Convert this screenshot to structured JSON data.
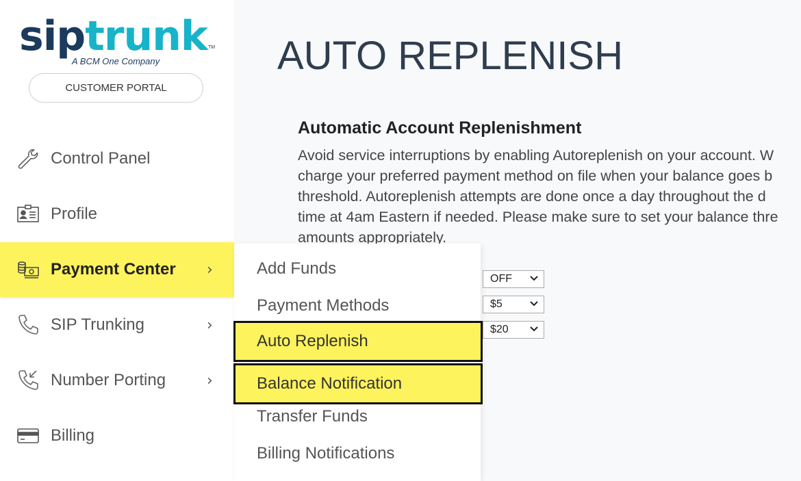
{
  "logo": {
    "sip": "sip",
    "trunk": "trunk",
    "tagline": "A BCM One Company",
    "tm": "TM"
  },
  "sidebar": {
    "portal_button": "CUSTOMER PORTAL",
    "items": [
      {
        "label": "Control Panel",
        "icon": "wrench-icon",
        "has_chevron": false
      },
      {
        "label": "Profile",
        "icon": "id-card-icon",
        "has_chevron": false
      },
      {
        "label": "Payment Center",
        "icon": "cash-stack-icon",
        "has_chevron": true,
        "active": true
      },
      {
        "label": "SIP Trunking",
        "icon": "phone-icon",
        "has_chevron": true
      },
      {
        "label": "Number Porting",
        "icon": "phone-incoming-icon",
        "has_chevron": true
      },
      {
        "label": "Billing",
        "icon": "credit-card-icon",
        "has_chevron": false
      }
    ],
    "chevron": "›"
  },
  "submenu": {
    "items": [
      {
        "label": "Add Funds"
      },
      {
        "label": "Payment Methods"
      },
      {
        "label": "Auto Replenish",
        "highlighted": true
      },
      {
        "label": "Balance Notification",
        "highlighted": true
      },
      {
        "label": "Transfer Funds"
      },
      {
        "label": "Billing Notifications"
      }
    ]
  },
  "main": {
    "title": "AUTO REPLENISH",
    "section_title": "Automatic Account Replenishment",
    "description_lines": [
      "Avoid service interruptions by enabling Autoreplenish on your account. W",
      "charge your preferred payment method on file when your balance goes b",
      "threshold. Autoreplenish attempts are done once a day throughout the d",
      "time at 4am Eastern if needed. Please make sure to set your balance thre",
      "amounts appropriately."
    ],
    "selects": [
      {
        "value": "OFF"
      },
      {
        "value": "$5"
      },
      {
        "value": "$20"
      }
    ]
  },
  "colors": {
    "highlight": "#fdf35c",
    "brand_dark": "#1b3a5c",
    "brand_teal": "#17b3c9",
    "title": "#2f3d4f"
  }
}
